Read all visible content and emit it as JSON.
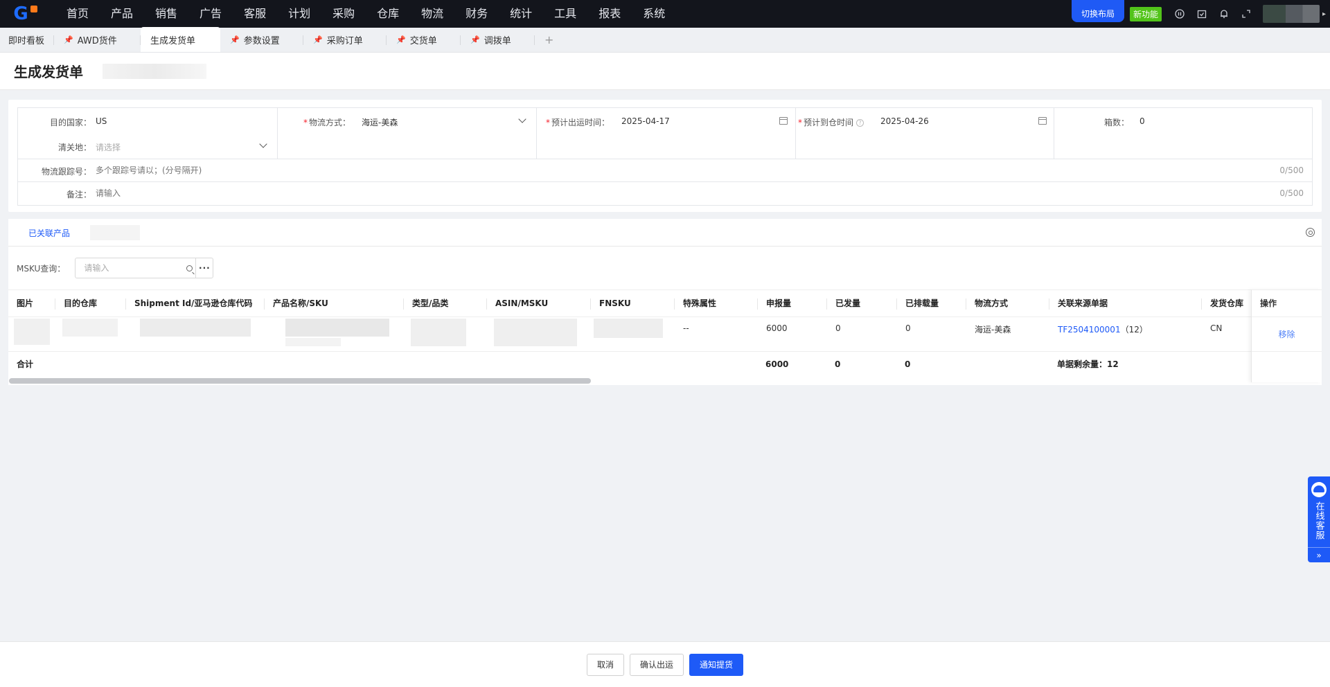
{
  "nav": {
    "items": [
      "首页",
      "产品",
      "销售",
      "广告",
      "客服",
      "计划",
      "采购",
      "仓库",
      "物流",
      "财务",
      "统计",
      "工具",
      "报表",
      "系统"
    ],
    "switch_layout": "切换布局",
    "new_feature": "新功能"
  },
  "tabs": [
    {
      "label": "即时看板",
      "pinned": false
    },
    {
      "label": "AWD货件",
      "pinned": true
    },
    {
      "label": "生成发货单",
      "pinned": false,
      "active": true
    },
    {
      "label": "参数设置",
      "pinned": true
    },
    {
      "label": "采购订单",
      "pinned": true
    },
    {
      "label": "交货单",
      "pinned": true
    },
    {
      "label": "调拨单",
      "pinned": true
    }
  ],
  "tab_add": "+",
  "page": {
    "title": "生成发货单"
  },
  "form": {
    "dest_country_label": "目的国家：",
    "dest_country_value": "US",
    "clearance_label": "清关地：",
    "clearance_placeholder": "请选择",
    "logistics_label": "物流方式：",
    "logistics_value": "海运-美森",
    "ship_date_label": "预计出运时间：",
    "ship_date_value": "2025-04-17",
    "arrive_date_label": "预计到仓时间",
    "arrive_date_value": "2025-04-26",
    "boxes_label": "箱数：",
    "boxes_value": "0",
    "tracking_label": "物流跟踪号：",
    "tracking_placeholder": "多个跟踪号请以；(分号隔开)",
    "tracking_counter": "0/500",
    "remark_label": "备注：",
    "remark_placeholder": "请输入",
    "remark_counter": "0/500"
  },
  "products": {
    "tab_label": "已关联产品",
    "query_label": "MSKU查询：",
    "search_placeholder": "请输入",
    "more": "···",
    "columns": [
      "图片",
      "目的仓库",
      "Shipment Id/亚马逊仓库代码",
      "产品名称/SKU",
      "类型/品类",
      "ASIN/MSKU",
      "FNSKU",
      "特殊属性",
      "申报量",
      "已发量",
      "已排载量",
      "物流方式",
      "关联来源单据",
      "发货仓库"
    ],
    "op_header": "操作",
    "row": {
      "special": "--",
      "declared": "6000",
      "shipped": "0",
      "loaded": "0",
      "logistics": "海运-美森",
      "source_doc": "TF2504100001",
      "source_count": "（12）",
      "warehouse": "CN",
      "op": "移除"
    },
    "footer": {
      "label": "合计",
      "declared": "6000",
      "shipped": "0",
      "loaded": "0",
      "remaining": "单据剩余量：12"
    }
  },
  "cs_float": {
    "text": "在线客服",
    "expand": "»"
  },
  "footer": {
    "cancel": "取消",
    "confirm_ship": "确认出运",
    "notify_pickup": "通知提货"
  },
  "colors": {
    "primary": "#1e5af7",
    "topnav_bg": "#13151c",
    "new_feature": "#52c41a",
    "required": "#f5222d"
  }
}
